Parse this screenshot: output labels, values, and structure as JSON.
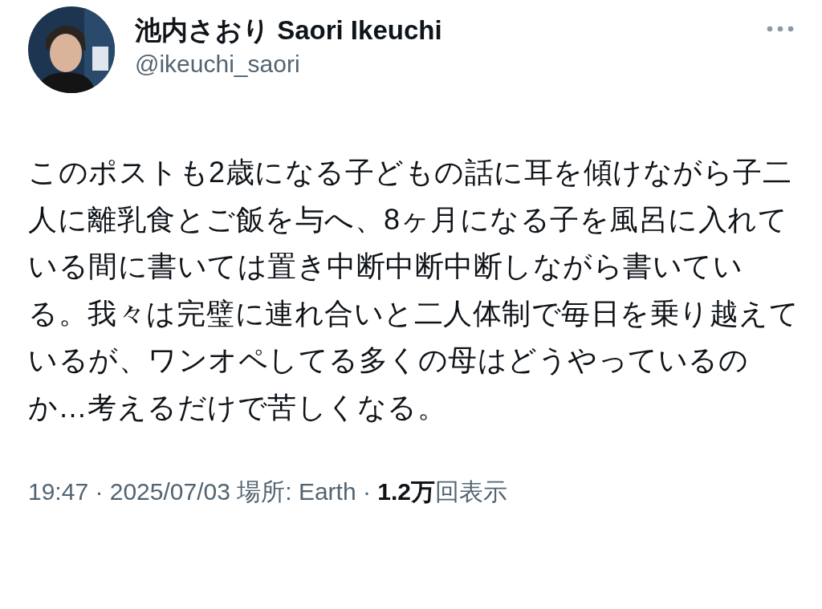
{
  "author": {
    "name": "池内さおり Saori Ikeuchi",
    "handle": "@ikeuchi_saori"
  },
  "body": "このポストも2歳になる子どもの話に耳を傾けながら子二人に離乳食とご飯を与へ、8ヶ月になる子を風呂に入れている間に書いては置き中断中断中断しながら書いている。我々は完璧に連れ合いと二人体制で毎日を乗り越えているが、ワンオペしてる多くの母はどうやっているのか…考えるだけで苦しくなる。",
  "meta": "19:47 · 2025/07/03 場所: Earth · **1.2万**回表示"
}
